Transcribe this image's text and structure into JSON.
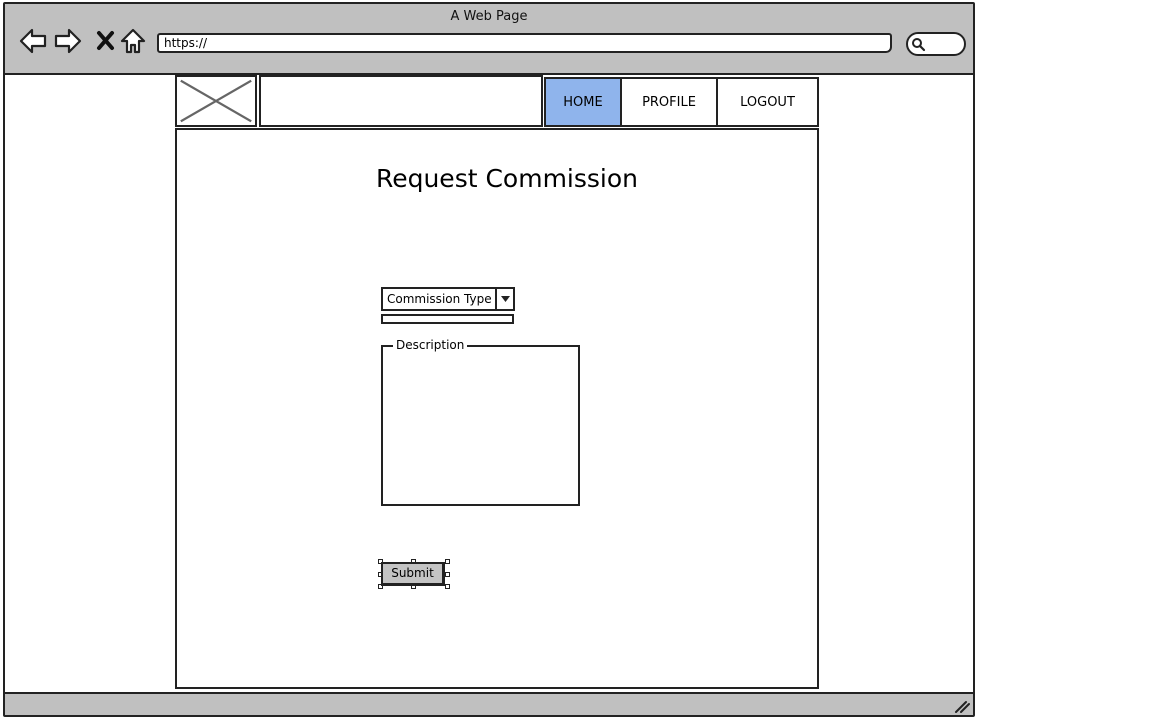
{
  "window": {
    "title": "A Web Page"
  },
  "toolbar": {
    "back_icon": "back-arrow-icon",
    "forward_icon": "forward-arrow-icon",
    "stop_icon": "close-icon",
    "home_icon": "home-icon",
    "url": "https://",
    "search_icon": "search-icon"
  },
  "header": {
    "logo_icon": "image-placeholder-icon",
    "nav": [
      {
        "label": "HOME",
        "active": true
      },
      {
        "label": "PROFILE",
        "active": false
      },
      {
        "label": "LOGOUT",
        "active": false
      }
    ],
    "active_color": "#8fb4ec"
  },
  "main": {
    "title": "Request Commission",
    "commission_select": {
      "value": "Commission Type"
    },
    "description": {
      "label": "Description",
      "value": ""
    },
    "submit_label": "Submit"
  },
  "statusbar": {
    "resize_icon": "resize-grip-icon"
  }
}
